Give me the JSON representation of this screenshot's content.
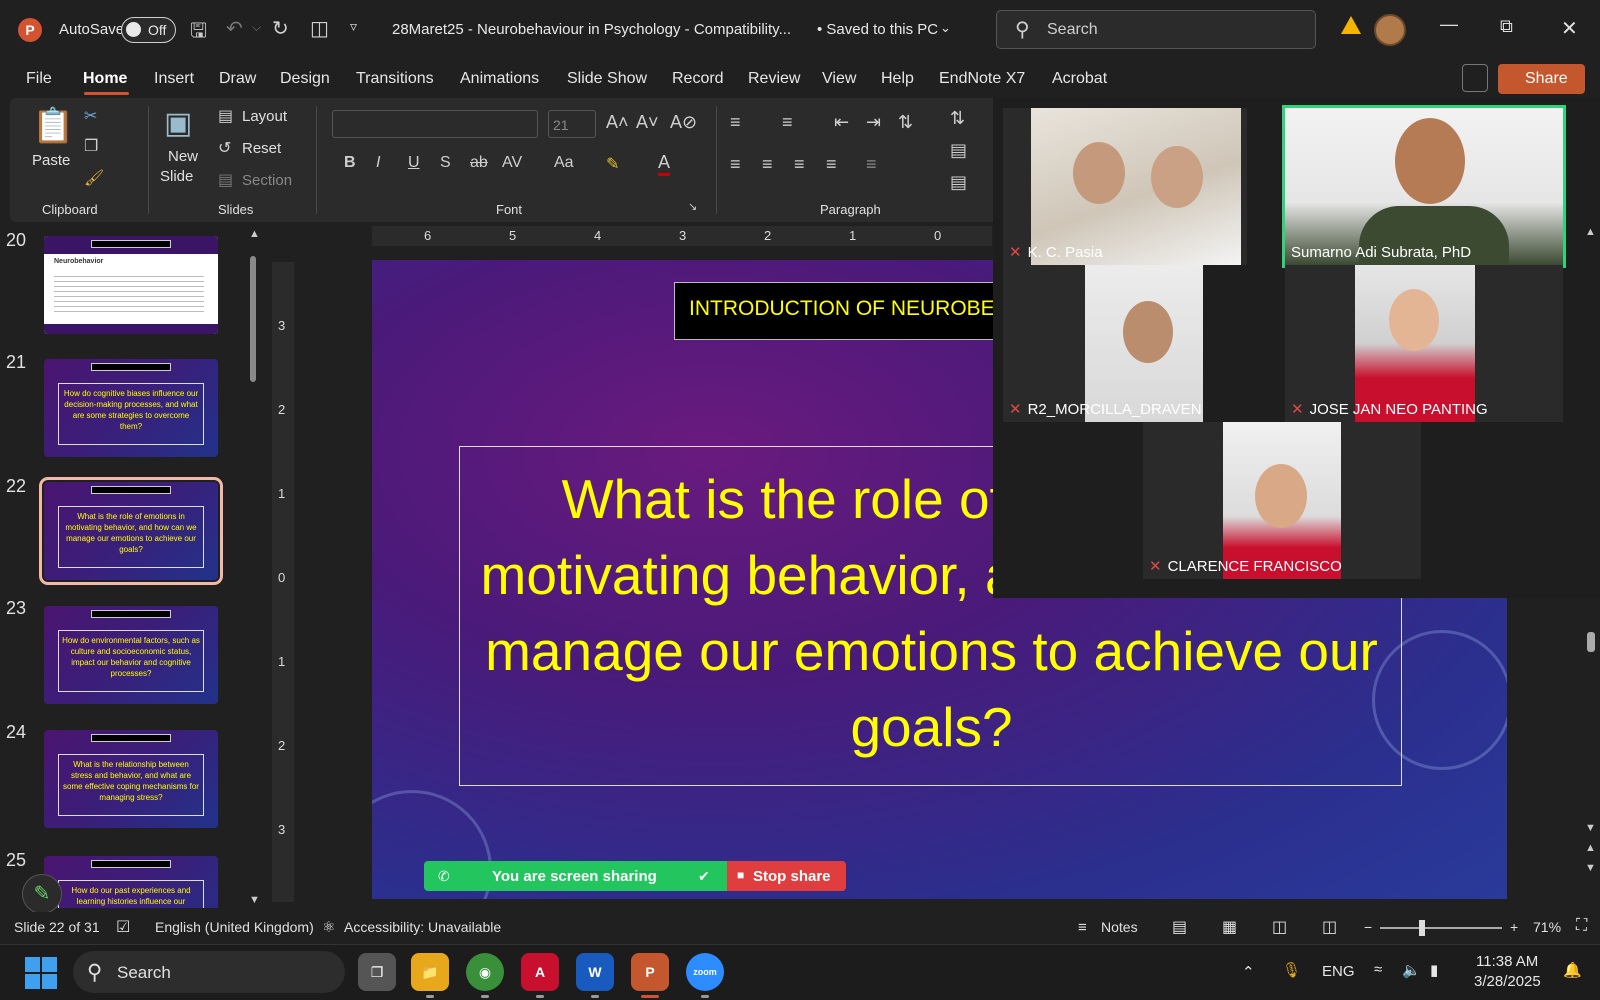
{
  "titlebar": {
    "autosave_label": "AutoSave",
    "autosave_state": "Off",
    "doc_title": "28Maret25 - Neurobehaviour in Psychology  -  Compatibility...",
    "save_status": "• Saved to this PC",
    "search_placeholder": "Search"
  },
  "ribbon_tabs": [
    "File",
    "Home",
    "Insert",
    "Draw",
    "Design",
    "Transitions",
    "Animations",
    "Slide Show",
    "Record",
    "Review",
    "View",
    "Help",
    "EndNote X7",
    "Acrobat"
  ],
  "active_tab": "Home",
  "share_label": "Share",
  "ribbon": {
    "paste": "Paste",
    "clipboard_label": "Clipboard",
    "new_slide": "New",
    "new_slide2": "Slide",
    "layout": "Layout",
    "reset": "Reset",
    "section": "Section",
    "slides_label": "Slides",
    "font_size": "21",
    "font_label": "Font",
    "paragraph_label": "Paragraph"
  },
  "thumbnails": [
    {
      "num": "20",
      "kind": "white",
      "title": "Neurobehavior"
    },
    {
      "num": "21",
      "kind": "question",
      "text": "How do cognitive biases influence our decision-making processes, and what are some strategies to overcome them?"
    },
    {
      "num": "22",
      "kind": "question",
      "text": "What is the role of emotions in motivating behavior, and how can we manage our emotions to achieve our goals?"
    },
    {
      "num": "23",
      "kind": "question",
      "text": "How do environmental factors, such as culture and socioeconomic status, impact our behavior and cognitive processes?"
    },
    {
      "num": "24",
      "kind": "question",
      "text": "What is the relationship between stress and behavior, and what are some effective coping mechanisms for managing stress?"
    },
    {
      "num": "25",
      "kind": "question",
      "text": "How do our past experiences and learning histories influence our"
    }
  ],
  "selected_slide": "22",
  "hruler_ticks": [
    "6",
    "5",
    "4",
    "3",
    "2",
    "1",
    "0"
  ],
  "vruler_ticks": [
    "3",
    "2",
    "1",
    "0",
    "1",
    "2",
    "3"
  ],
  "slide": {
    "header": "INTRODUCTION OF NEUROBEH",
    "question": "What is the role of emotions in motivating behavior, and how can we manage our emotions to achieve our goals?"
  },
  "sharebar": {
    "sharing": "You are screen sharing",
    "stop": "Stop share"
  },
  "zoom_participants": [
    {
      "name": "K. C. Pasia",
      "muted": true
    },
    {
      "name": "Sumarno Adi Subrata, PhD",
      "muted": false,
      "speaking": true
    },
    {
      "name": "R2_MORCILLA_DRAVEN",
      "muted": true
    },
    {
      "name": "JOSE JAN NEO PANTING",
      "muted": true
    },
    {
      "name": "CLARENCE FRANCISCO",
      "muted": true
    }
  ],
  "status": {
    "slide_count": "Slide 22 of 31",
    "language": "English (United Kingdom)",
    "accessibility": "Accessibility: Unavailable",
    "notes": "Notes",
    "zoom_level": "71%"
  },
  "taskbar": {
    "search_placeholder": "Search",
    "lang": "ENG",
    "time": "11:38 AM",
    "date": "3/28/2025"
  },
  "colors": {
    "accent": "#d35230",
    "slide_text": "#ffff00",
    "share_green": "#22c55e",
    "stop_red": "#e03e3e",
    "speaker_outline": "#2ed47a"
  }
}
